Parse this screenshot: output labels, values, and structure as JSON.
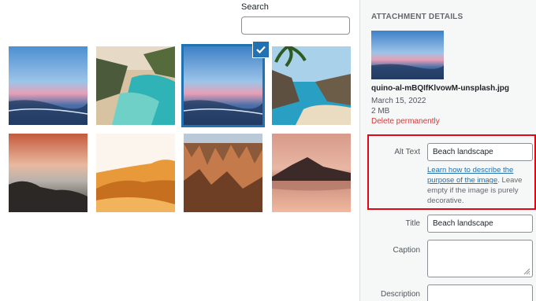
{
  "search": {
    "label": "Search",
    "value": ""
  },
  "grid": {
    "items": [
      {
        "name": "sunset-beach-1"
      },
      {
        "name": "cove-waterfall"
      },
      {
        "name": "sunset-beach-2",
        "selected": true
      },
      {
        "name": "palm-cove"
      },
      {
        "name": "misty-shore"
      },
      {
        "name": "desert-dunes"
      },
      {
        "name": "canyon-hoodoos"
      },
      {
        "name": "lake-mountain"
      }
    ]
  },
  "sidebar": {
    "heading": "ATTACHMENT DETAILS",
    "filename": "quino-al-mBQIfKlvowM-unsplash.jpg",
    "date": "March 15, 2022",
    "size": "2 MB",
    "delete_label": "Delete permanently",
    "alt_text": {
      "label": "Alt Text",
      "value": "Beach landscape",
      "help_link": "Learn how to describe the purpose of the image",
      "help_text": ". Leave empty if the image is purely decorative."
    },
    "title": {
      "label": "Title",
      "value": "Beach landscape"
    },
    "caption": {
      "label": "Caption",
      "value": ""
    },
    "description": {
      "label": "Description",
      "value": ""
    }
  },
  "colors": {
    "accent": "#2271b1",
    "delete": "#d63638",
    "highlight": "#e30613"
  }
}
